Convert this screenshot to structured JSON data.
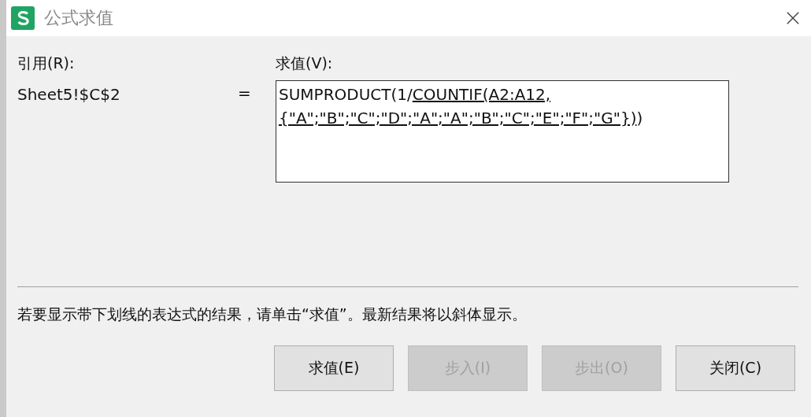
{
  "window": {
    "title": "公式求值"
  },
  "reference": {
    "label": "引用(R):",
    "value": "Sheet5!$C$2"
  },
  "equals": "=",
  "evaluation": {
    "label": "求值(V):",
    "segments": [
      {
        "text": "SUMPRODUCT(1/",
        "underlined": false
      },
      {
        "text": "COUNTIF(A2:A12,{\"A\";\"B\";\"C\";\"D\";\"A\";\"A\";\"B\";\"C\";\"E\";\"F\";\"G\"})",
        "underlined": true
      },
      {
        "text": ")",
        "underlined": false
      }
    ]
  },
  "hint": "若要显示带下划线的表达式的结果，请单击“求值”。最新结果将以斜体显示。",
  "buttons": [
    {
      "label": "求值(E)",
      "disabled": false
    },
    {
      "label": "步入(I)",
      "disabled": true
    },
    {
      "label": "步出(O)",
      "disabled": true
    },
    {
      "label": "关闭(C)",
      "disabled": false
    }
  ]
}
